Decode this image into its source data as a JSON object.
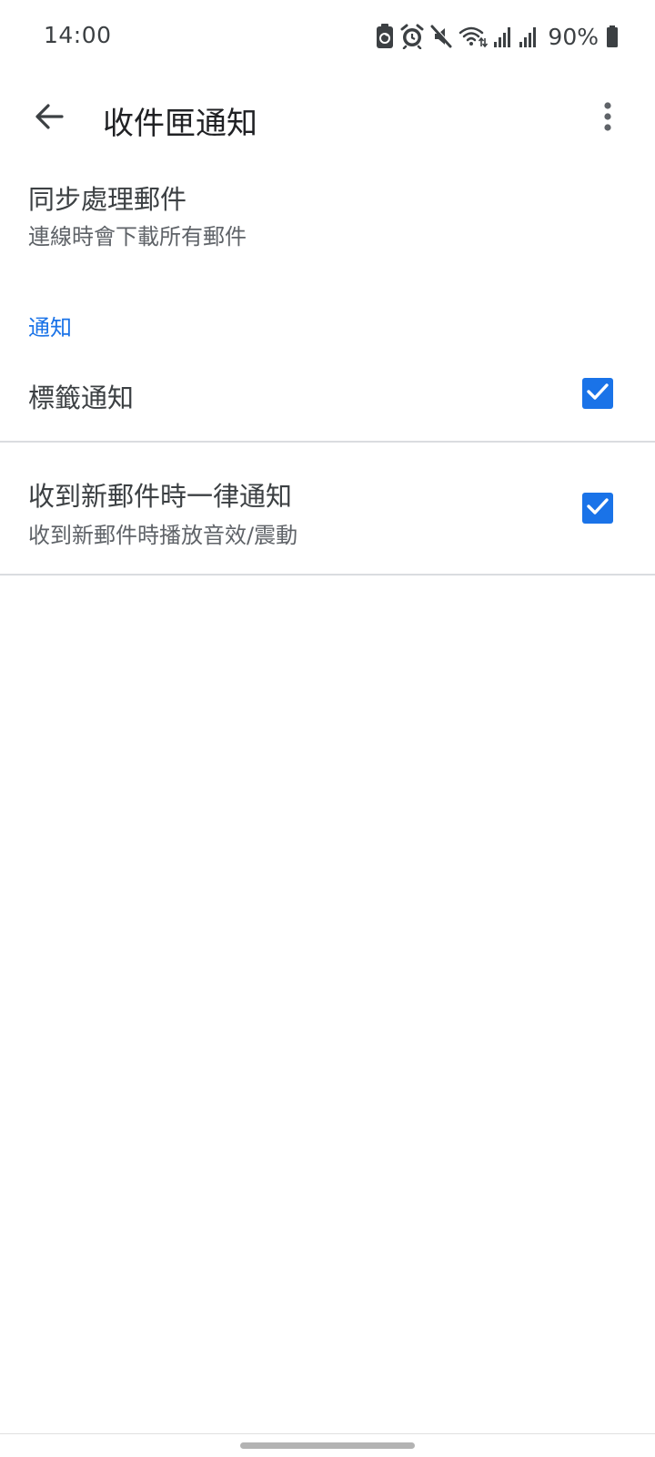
{
  "status_bar": {
    "time": "14:00",
    "battery_percent": "90%",
    "icons": [
      "battery-saver-icon",
      "alarm-icon",
      "mute-icon",
      "wifi-icon",
      "signal-icon",
      "signal-icon",
      "battery-icon"
    ]
  },
  "app_bar": {
    "title": "收件匣通知",
    "back_icon": "arrow-back-icon",
    "overflow_icon": "more-vert-icon"
  },
  "settings": {
    "sync": {
      "title": "同步處理郵件",
      "summary": "連線時會下載所有郵件"
    },
    "notifications_header": "通知",
    "label_notifications": {
      "title": "標籤通知",
      "checked": true
    },
    "notify_every_message": {
      "title": "收到新郵件時一律通知",
      "summary": "收到新郵件時播放音效/震動",
      "checked": true
    }
  },
  "colors": {
    "accent": "#1a73e8",
    "divider": "#dadce0",
    "text_primary": "#3c4043",
    "text_secondary": "#5f6368"
  }
}
